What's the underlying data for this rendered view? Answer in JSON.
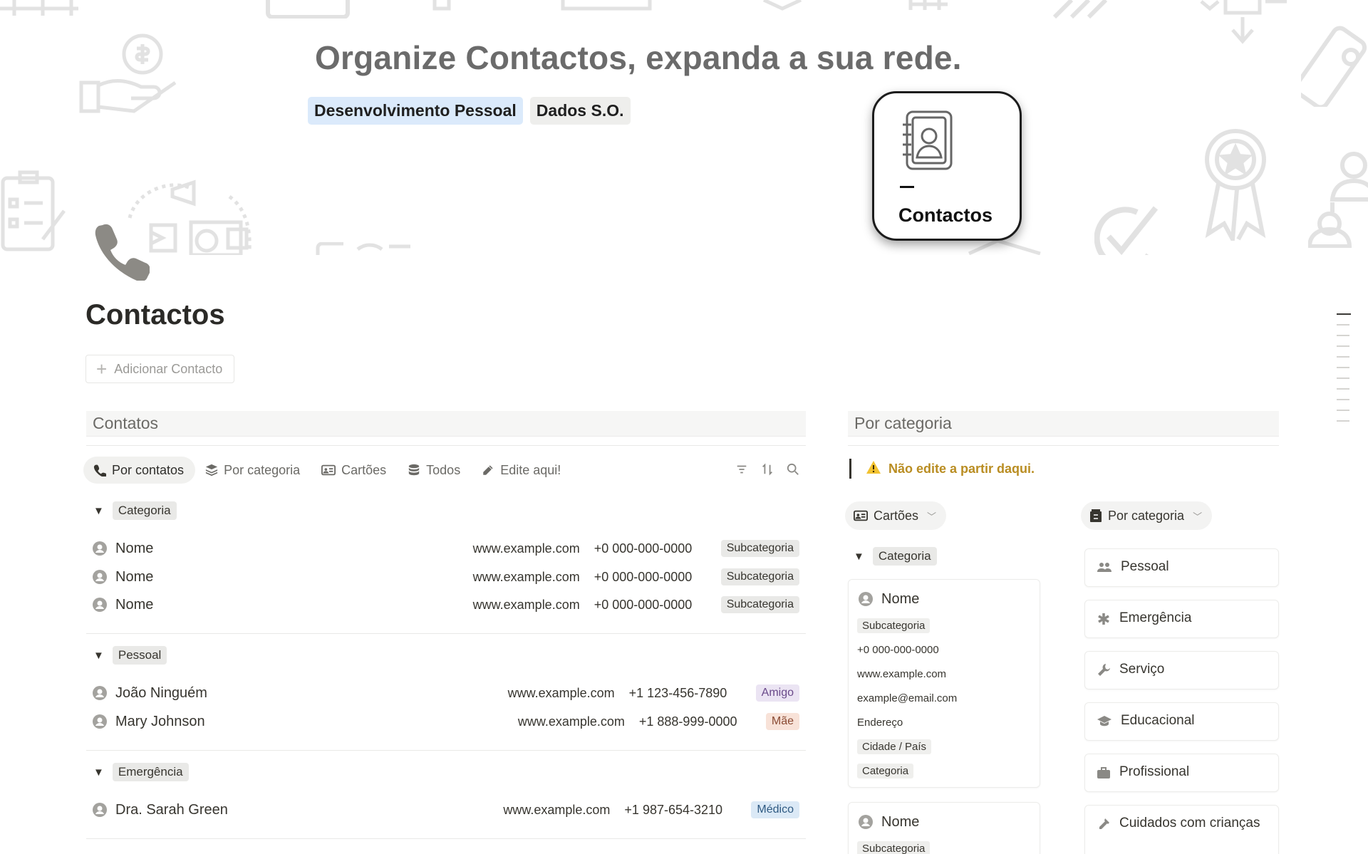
{
  "cover": {
    "title": "Organize Contactos, expanda a sua rede.",
    "tags": [
      "Desenvolvimento Pessoal",
      "Dados S.O."
    ],
    "badge_label": "Contactos"
  },
  "page": {
    "title": "Contactos",
    "add_button": "Adicionar Contacto"
  },
  "left": {
    "section_title": "Contatos",
    "views": [
      "Por contatos",
      "Por categoria",
      "Cartões",
      "Todos",
      "Edite aqui!"
    ],
    "groups": [
      {
        "name": "Categoria",
        "rows": [
          {
            "name": "Nome",
            "site": "www.example.com",
            "phone": "+0 000-000-0000",
            "tag": "Subcategoria"
          },
          {
            "name": "Nome",
            "site": "www.example.com",
            "phone": "+0 000-000-0000",
            "tag": "Subcategoria"
          },
          {
            "name": "Nome",
            "site": "www.example.com",
            "phone": "+0 000-000-0000",
            "tag": "Subcategoria"
          }
        ]
      },
      {
        "name": "Pessoal",
        "rows": [
          {
            "name": "João Ninguém",
            "site": "www.example.com",
            "phone": "+1 123-456-7890",
            "tag": "Amigo"
          },
          {
            "name": "Mary Johnson",
            "site": "www.example.com",
            "phone": "+1 888-999-0000",
            "tag": "Mãe"
          }
        ]
      },
      {
        "name": "Emergência",
        "rows": [
          {
            "name": "Dra. Sarah Green",
            "site": "www.example.com",
            "phone": "+1 987-654-3210",
            "tag": "Médico"
          }
        ]
      }
    ]
  },
  "right": {
    "section_title": "Por categoria",
    "warning": "Não edite a partir daqui.",
    "cards_button": "Cartões",
    "category_button": "Por categoria",
    "group_name": "Categoria",
    "card1": {
      "name": "Nome",
      "subcategory": "Subcategoria",
      "phone": "+0 000-000-0000",
      "site": "www.example.com",
      "email": "example@email.com",
      "address": "Endereço",
      "city": "Cidade / País",
      "category": "Categoria"
    },
    "card2": {
      "name": "Nome",
      "subcategory": "Subcategoria"
    },
    "categories": [
      "Pessoal",
      "Emergência",
      "Serviço",
      "Educacional",
      "Profissional",
      "Cuidados com crianças"
    ]
  },
  "colors": {
    "accent_warning": "#b98d22",
    "tag_blue": "#dbeafb",
    "text": "#37352f"
  }
}
